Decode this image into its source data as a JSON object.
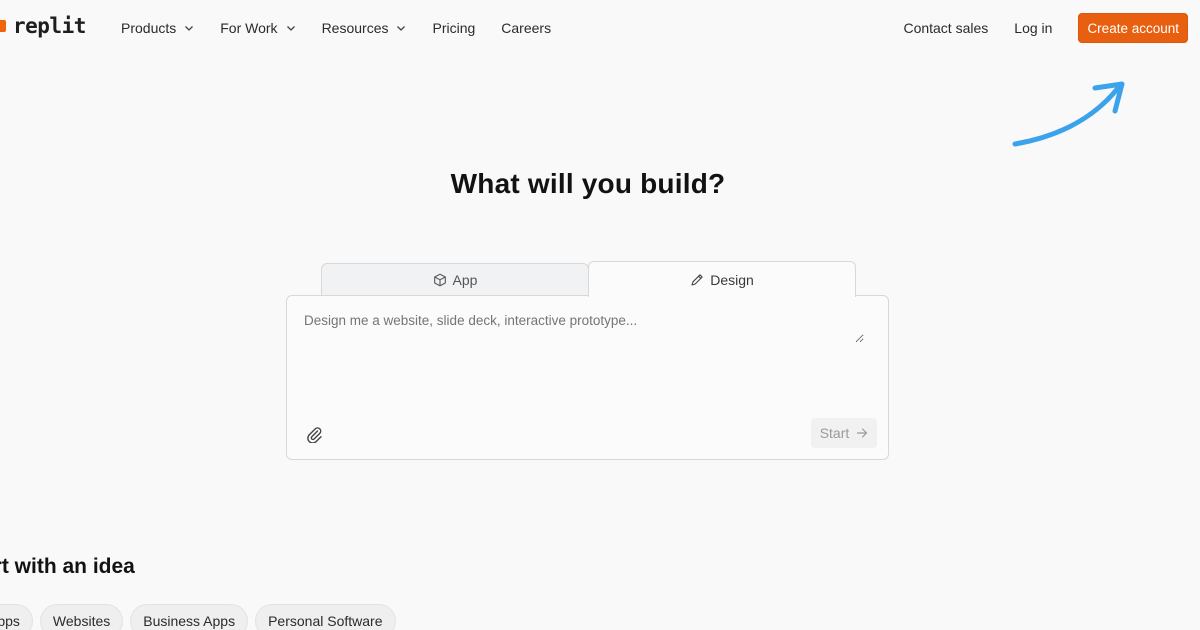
{
  "header": {
    "logo_text": "replit",
    "nav": [
      {
        "label": "Products",
        "has_dropdown": true
      },
      {
        "label": "For Work",
        "has_dropdown": true
      },
      {
        "label": "Resources",
        "has_dropdown": true
      },
      {
        "label": "Pricing",
        "has_dropdown": false
      },
      {
        "label": "Careers",
        "has_dropdown": false
      }
    ],
    "contact_sales": "Contact sales",
    "log_in": "Log in",
    "create_account": "Create account"
  },
  "hero": {
    "title": "What will you build?"
  },
  "tabs": [
    {
      "label": "App",
      "icon": "cube-icon",
      "active": false
    },
    {
      "label": "Design",
      "icon": "pen-icon",
      "active": true
    }
  ],
  "prompt": {
    "placeholder": "Design me a website, slide deck, interactive prototype...",
    "value": "",
    "start_label": "Start"
  },
  "ideas": {
    "title": "art with an idea",
    "chips": [
      "Apps",
      "Websites",
      "Business Apps",
      "Personal Software"
    ]
  },
  "colors": {
    "brand": "#f26207",
    "create_button": "#e8600f",
    "annotation_arrow": "#3ba3ec",
    "background": "#f9f9f9"
  }
}
